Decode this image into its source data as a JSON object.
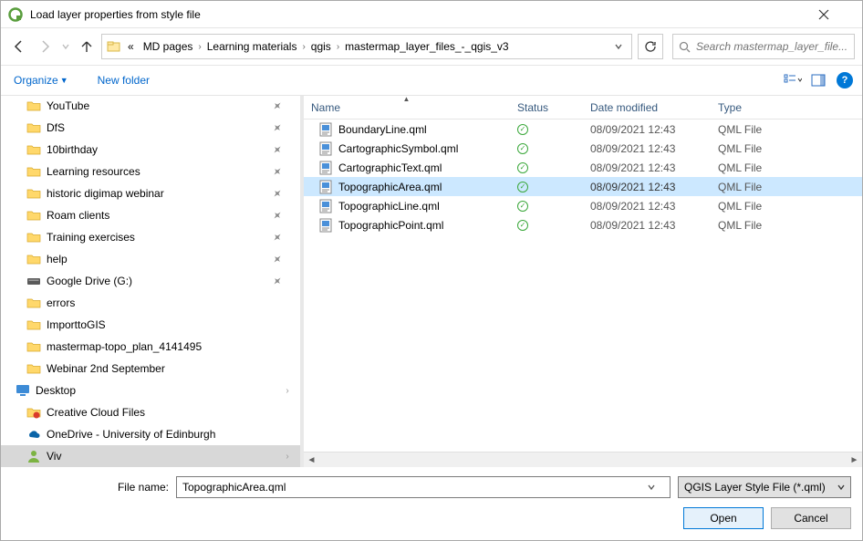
{
  "window": {
    "title": "Load layer properties from style file"
  },
  "breadcrumbs": {
    "prefix": "«",
    "items": [
      "MD pages",
      "Learning materials",
      "qgis",
      "mastermap_layer_files_-_qgis_v3"
    ]
  },
  "search": {
    "placeholder": "Search mastermap_layer_file..."
  },
  "toolbar": {
    "organize": "Organize",
    "new_folder": "New folder"
  },
  "tree": [
    {
      "label": "YouTube",
      "icon": "folder",
      "pin": true
    },
    {
      "label": "DfS",
      "icon": "folder",
      "pin": true
    },
    {
      "label": "10birthday",
      "icon": "folder",
      "pin": true
    },
    {
      "label": "Learning resources",
      "icon": "folder",
      "pin": true
    },
    {
      "label": "historic digimap webinar",
      "icon": "folder",
      "pin": true
    },
    {
      "label": "Roam clients",
      "icon": "folder",
      "pin": true
    },
    {
      "label": "Training exercises",
      "icon": "folder",
      "pin": true
    },
    {
      "label": "help",
      "icon": "folder",
      "pin": true
    },
    {
      "label": "Google Drive (G:)",
      "icon": "drive",
      "pin": true
    },
    {
      "label": "errors",
      "icon": "folder"
    },
    {
      "label": "ImporttoGIS",
      "icon": "folder"
    },
    {
      "label": "mastermap-topo_plan_4141495",
      "icon": "folder"
    },
    {
      "label": "Webinar 2nd September",
      "icon": "folder"
    },
    {
      "label": "Desktop",
      "icon": "desktop",
      "level": 1,
      "expand": true
    },
    {
      "label": "Creative Cloud Files",
      "icon": "cc"
    },
    {
      "label": "OneDrive - University of Edinburgh",
      "icon": "onedrive"
    },
    {
      "label": "Viv",
      "icon": "user",
      "selected": true,
      "expand": true
    }
  ],
  "columns": {
    "name": "Name",
    "status": "Status",
    "date": "Date modified",
    "type": "Type"
  },
  "files": [
    {
      "name": "BoundaryLine.qml",
      "date": "08/09/2021 12:43",
      "type": "QML File"
    },
    {
      "name": "CartographicSymbol.qml",
      "date": "08/09/2021 12:43",
      "type": "QML File"
    },
    {
      "name": "CartographicText.qml",
      "date": "08/09/2021 12:43",
      "type": "QML File"
    },
    {
      "name": "TopographicArea.qml",
      "date": "08/09/2021 12:43",
      "type": "QML File",
      "selected": true
    },
    {
      "name": "TopographicLine.qml",
      "date": "08/09/2021 12:43",
      "type": "QML File"
    },
    {
      "name": "TopographicPoint.qml",
      "date": "08/09/2021 12:43",
      "type": "QML File"
    }
  ],
  "footer": {
    "filename_label": "File name:",
    "filename_value": "TopographicArea.qml",
    "filter": "QGIS Layer Style File (*.qml)",
    "open": "Open",
    "cancel": "Cancel"
  }
}
